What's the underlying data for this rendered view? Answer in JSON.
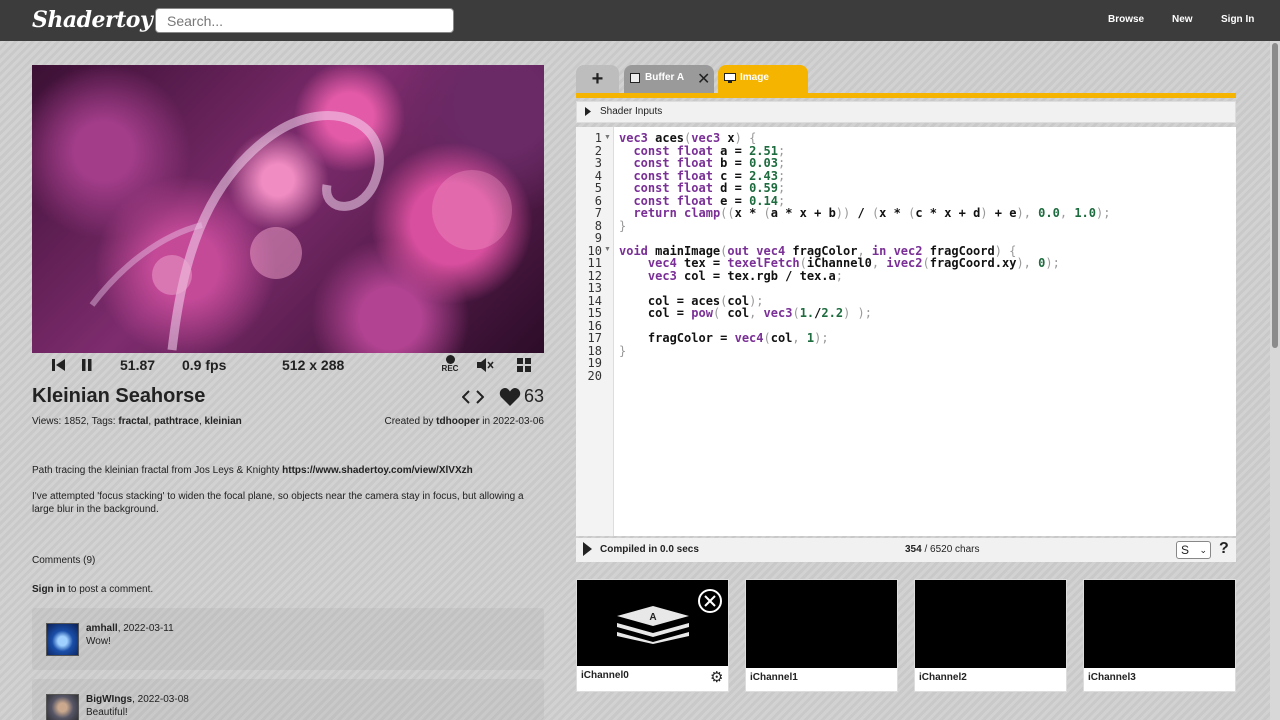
{
  "header": {
    "logo": "Shadertoy",
    "search_placeholder": "Search...",
    "nav": [
      "Browse",
      "New",
      "Sign In"
    ]
  },
  "player": {
    "time": "51.87",
    "fps": "0.9 fps",
    "resolution": "512 x 288",
    "rec_label": "REC"
  },
  "shader": {
    "title": "Kleinian Seahorse",
    "likes": "63",
    "views_label": "Views: 1852, Tags:",
    "tags": [
      "fractal",
      "pathtrace",
      "kleinian"
    ],
    "created_prefix": "Created by",
    "author": "tdhooper",
    "created_date": "in 2022-03-06",
    "description_1": "Path tracing the kleinian fractal from Jos Leys & Knighty",
    "description_link": "https://www.shadertoy.com/view/XlVXzh",
    "description_2": "I've attempted 'focus stacking' to widen the focal plane, so objects near the camera stay in focus, but allowing a large blur in the background."
  },
  "comments": {
    "header": "Comments (9)",
    "signin_link": "Sign in",
    "signin_text": "to post a comment.",
    "items": [
      {
        "user": "amhall",
        "date": ", 2022-03-11",
        "text": "Wow!"
      },
      {
        "user": "BigWIngs",
        "date": ", 2022-03-08",
        "text": "Beautiful!"
      }
    ]
  },
  "editor": {
    "add_tab": "+",
    "tabs": [
      {
        "label": "Buffer A",
        "active": false
      },
      {
        "label": "Image",
        "active": true
      }
    ],
    "shader_inputs": "Shader Inputs",
    "line_numbers": [
      "1",
      "2",
      "3",
      "4",
      "5",
      "6",
      "7",
      "8",
      "9",
      "10",
      "11",
      "12",
      "13",
      "14",
      "15",
      "16",
      "17",
      "18",
      "19",
      "20"
    ],
    "compiled": "Compiled in 0.0 secs",
    "chars_used": "354",
    "chars_total": " / 6520 chars",
    "size_option": "S",
    "help": "?"
  },
  "channels": [
    {
      "label": "iChannel0"
    },
    {
      "label": "iChannel1"
    },
    {
      "label": "iChannel2"
    },
    {
      "label": "iChannel3"
    }
  ],
  "colors": {
    "accent": "#f5b400",
    "topbar": "#3c3c3c",
    "keyword": "#7a2f96",
    "number": "#1d6b3e"
  }
}
